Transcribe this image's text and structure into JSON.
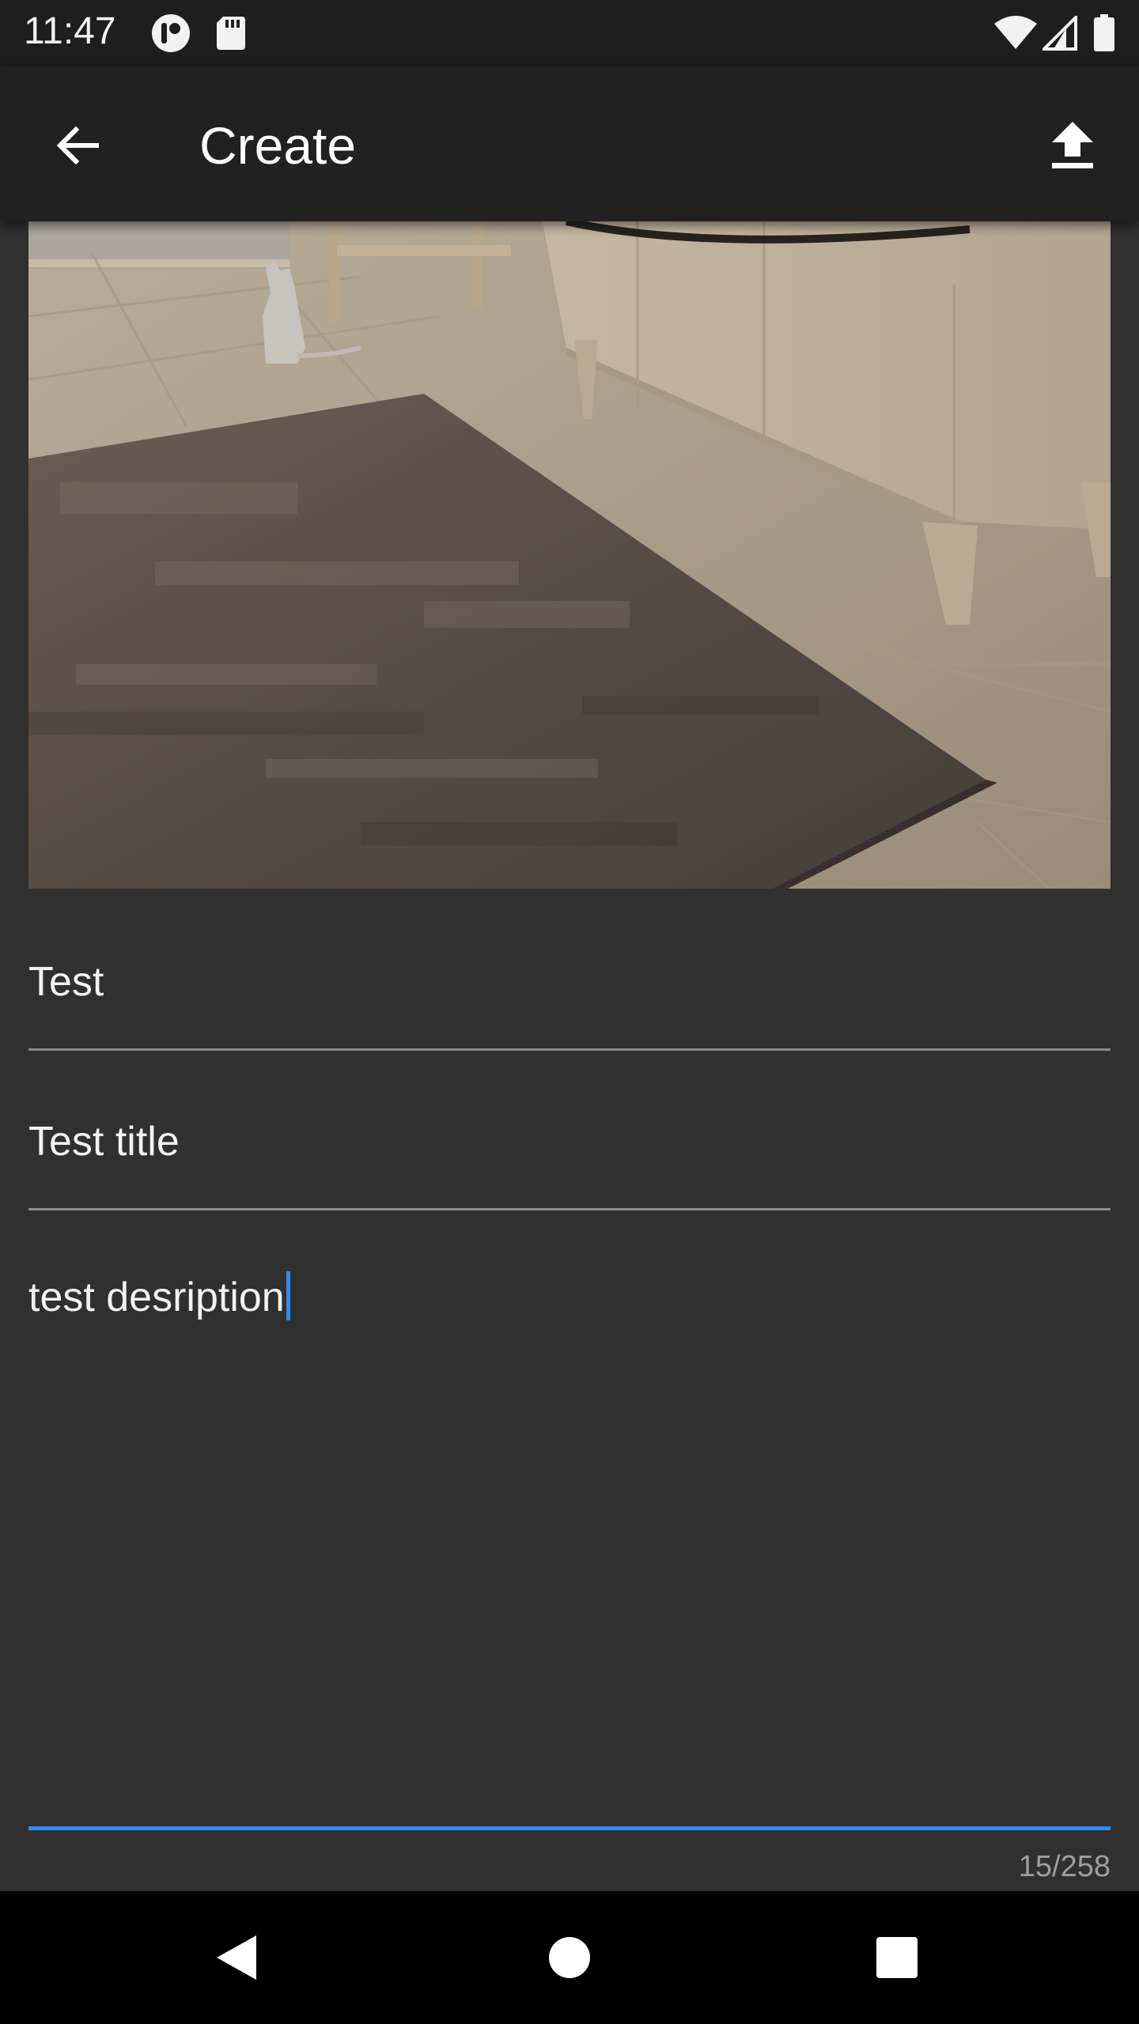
{
  "status_bar": {
    "time": "11:47",
    "left_icons": [
      "notification-icon",
      "sd-card-icon"
    ],
    "right_icons": [
      "wifi-icon",
      "cell-signal-icon",
      "battery-icon"
    ]
  },
  "app_bar": {
    "title": "Create",
    "back_icon": "arrow-back-icon",
    "action_icon": "upload-icon"
  },
  "image": {
    "description_icon": "photo-preview"
  },
  "form": {
    "field_1": {
      "value": "Test"
    },
    "field_2": {
      "value": "Test title"
    },
    "description": {
      "value": "test desription"
    },
    "counter": "15/258"
  },
  "nav_bar": {
    "buttons": [
      "back-triangle-icon",
      "home-circle-icon",
      "recents-square-icon"
    ]
  },
  "colors": {
    "background": "#303030",
    "app_bar": "#212121",
    "accent": "#2f8ef4",
    "divider": "#8a8a8a"
  }
}
